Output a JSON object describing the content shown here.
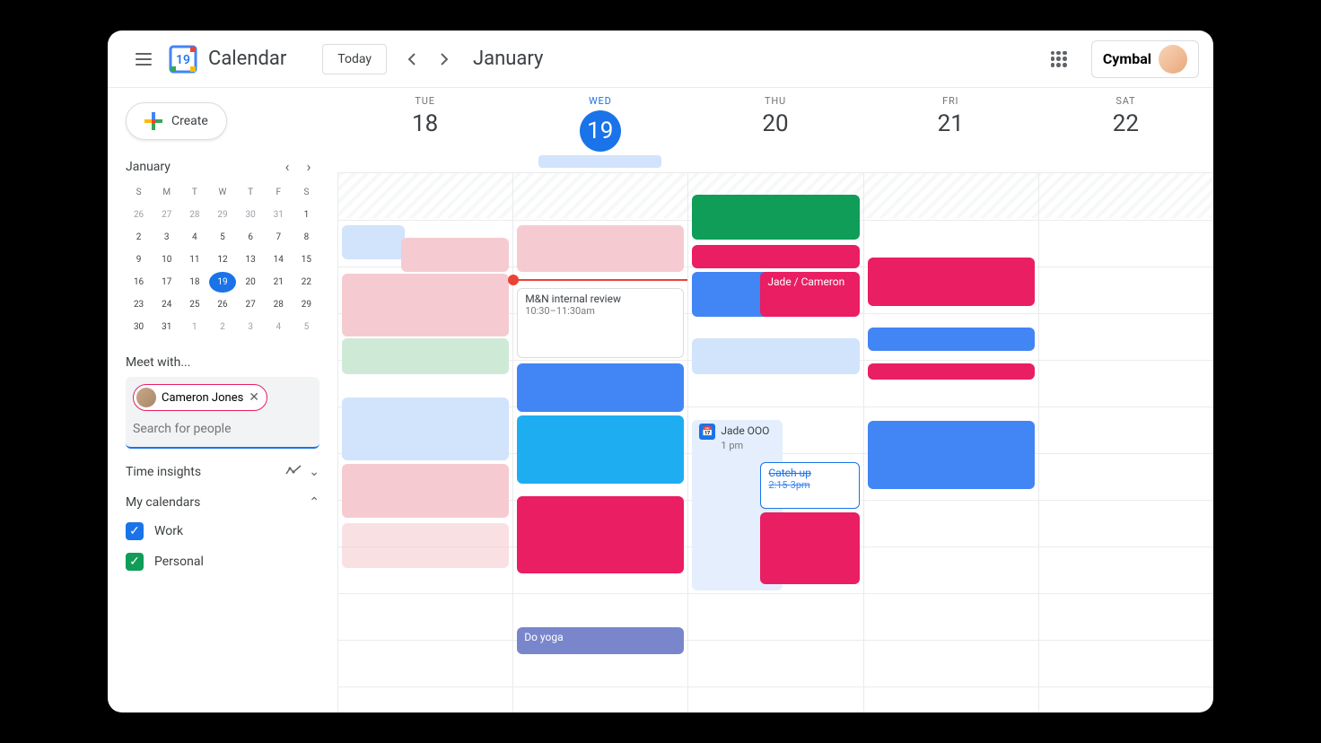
{
  "header": {
    "appName": "Calendar",
    "todayLabel": "Today",
    "monthLabel": "January",
    "brand": "Cymbal"
  },
  "sidebar": {
    "createLabel": "Create",
    "miniCal": {
      "title": "January",
      "dow": [
        "S",
        "M",
        "T",
        "W",
        "T",
        "F",
        "S"
      ],
      "days": [
        {
          "n": "26",
          "o": true
        },
        {
          "n": "27",
          "o": true
        },
        {
          "n": "28",
          "o": true
        },
        {
          "n": "29",
          "o": true
        },
        {
          "n": "30",
          "o": true
        },
        {
          "n": "31",
          "o": true
        },
        {
          "n": "1"
        },
        {
          "n": "2"
        },
        {
          "n": "3"
        },
        {
          "n": "4"
        },
        {
          "n": "5"
        },
        {
          "n": "6"
        },
        {
          "n": "7"
        },
        {
          "n": "8"
        },
        {
          "n": "9"
        },
        {
          "n": "10"
        },
        {
          "n": "11"
        },
        {
          "n": "12"
        },
        {
          "n": "13"
        },
        {
          "n": "14"
        },
        {
          "n": "15"
        },
        {
          "n": "16"
        },
        {
          "n": "17"
        },
        {
          "n": "18"
        },
        {
          "n": "19",
          "today": true
        },
        {
          "n": "20"
        },
        {
          "n": "21"
        },
        {
          "n": "22"
        },
        {
          "n": "23"
        },
        {
          "n": "24"
        },
        {
          "n": "25"
        },
        {
          "n": "26"
        },
        {
          "n": "27"
        },
        {
          "n": "28"
        },
        {
          "n": "29"
        },
        {
          "n": "30"
        },
        {
          "n": "31"
        },
        {
          "n": "1",
          "o": true
        },
        {
          "n": "2",
          "o": true
        },
        {
          "n": "3",
          "o": true
        },
        {
          "n": "4",
          "o": true
        },
        {
          "n": "5",
          "o": true
        }
      ]
    },
    "meetWithLabel": "Meet with...",
    "meetChip": "Cameron Jones",
    "searchPlaceholder": "Search for people",
    "timeInsights": "Time insights",
    "myCalendars": "My calendars",
    "calendars": [
      {
        "name": "Work",
        "color": "blue"
      },
      {
        "name": "Personal",
        "color": "green"
      }
    ]
  },
  "dayHeaders": [
    {
      "dow": "TUE",
      "num": "18"
    },
    {
      "dow": "WED",
      "num": "19",
      "today": true,
      "allday": true
    },
    {
      "dow": "THU",
      "num": "20"
    },
    {
      "dow": "FRI",
      "num": "21"
    },
    {
      "dow": "SAT",
      "num": "22"
    }
  ],
  "events": {
    "internalReview": {
      "title": "M&N internal review",
      "time": "10:30–11:30am"
    },
    "jadeCameron": {
      "title": "Jade / Cameron"
    },
    "jadeOOO": {
      "title": "Jade OOO",
      "time": "1 pm"
    },
    "catchUp": {
      "title": "Catch up",
      "time": "2:15-3pm"
    },
    "doYoga": {
      "title": "Do yoga"
    }
  }
}
